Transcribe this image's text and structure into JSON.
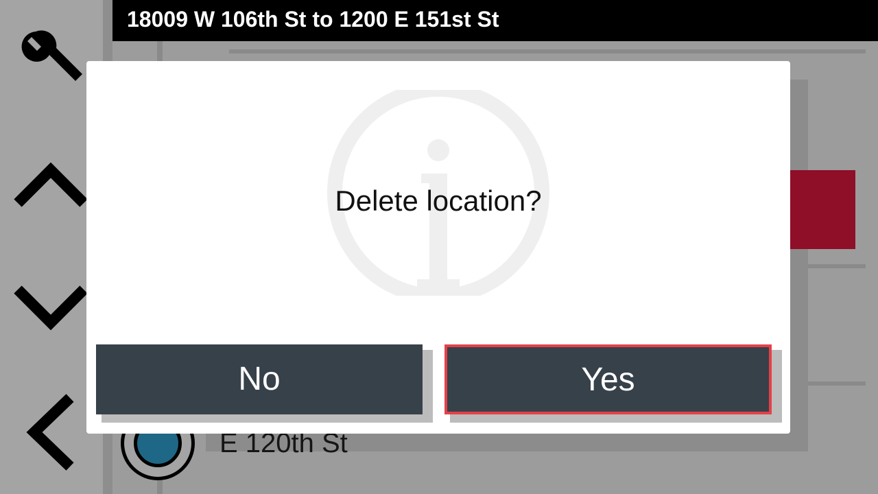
{
  "header": {
    "title": "18009 W 106th St to 1200 E 151st St"
  },
  "nav": {
    "icons": [
      "wrench-icon",
      "chevron-up-icon",
      "chevron-down-icon",
      "chevron-left-icon"
    ]
  },
  "background": {
    "location_label": "E 120th St"
  },
  "dialog": {
    "message": "Delete location?",
    "no_label": "No",
    "yes_label": "Yes"
  },
  "colors": {
    "header_bg": "#000000",
    "button_bg": "#37414a",
    "focus_outline": "#e5414a",
    "marker_fill": "#1f6786",
    "alert_red": "#8f0e28"
  }
}
